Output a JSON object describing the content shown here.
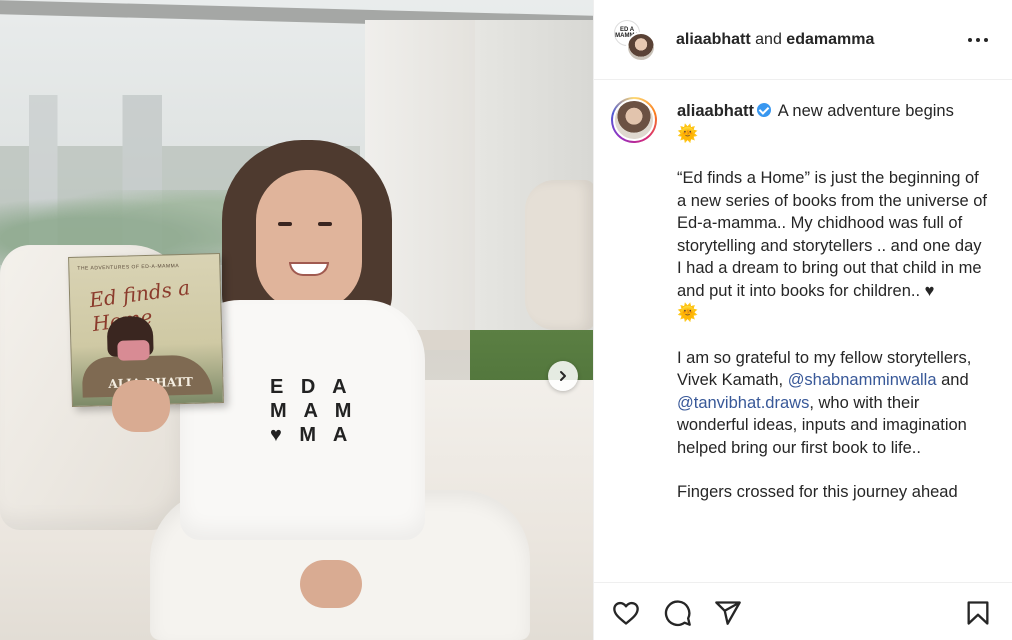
{
  "media": {
    "book": {
      "series": "THE ADVENTURES OF ED-A-MAMMA",
      "title": "Ed finds a Home",
      "author": "ALIA BHATT"
    },
    "shirt_print": "E D A\nM A M\n♥ M A",
    "next_icon": "chevron-right-icon"
  },
  "header": {
    "avatar_text": "ED A MAMMA",
    "user1": "aliaabhatt",
    "and": "and",
    "user2": "edamamma",
    "more_icon": "more-horizontal-icon"
  },
  "caption": {
    "username": "aliaabhatt",
    "intro": "A new adventure begins",
    "sun": "🌞",
    "para1": "“Ed finds a Home” is just the beginning of a new series of books from the universe of Ed-a-mamma.. My chidhood was full of storytelling and storytellers .. and one day I had a dream to bring out that child in me and put it into books for children.. ♥",
    "para2_a": "I am so grateful to my fellow storytellers, Vivek Kamath,",
    "mention1": "@shabnamminwalla",
    "para2_b": "and",
    "mention2": "@tanvibhat.draws",
    "para2_c": ", who with their wonderful ideas, inputs and imagination helped bring our first book to life..",
    "para3": "Fingers crossed for this journey ahead"
  },
  "actions": {
    "like_icon": "heart-icon",
    "comment_icon": "comment-icon",
    "share_icon": "send-icon",
    "save_icon": "bookmark-icon"
  },
  "colors": {
    "mention": "#385898",
    "verified": "#3897f0"
  }
}
